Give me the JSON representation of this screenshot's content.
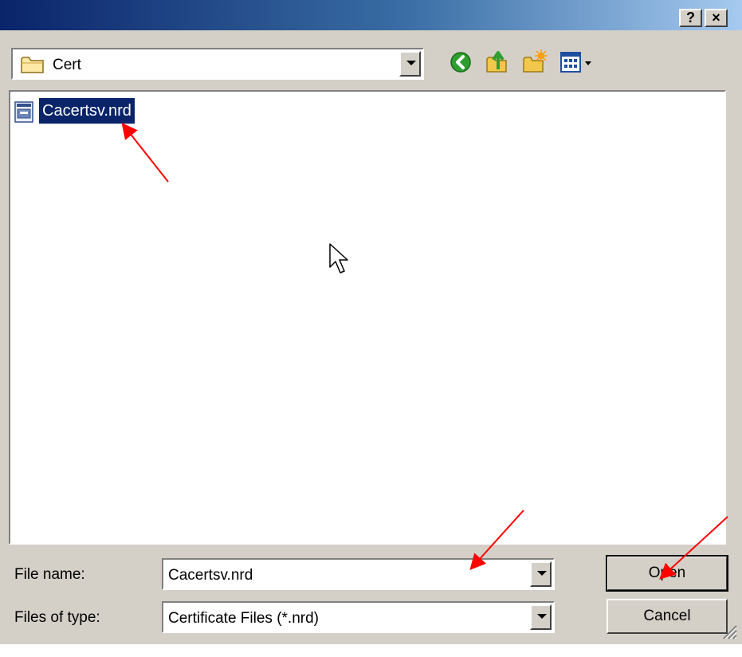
{
  "titlebar": {
    "help_label": "?",
    "close_label": "×"
  },
  "look_in": {
    "value": "Cert",
    "icon": "folder-icon"
  },
  "toolbar": {
    "back_icon": "back-icon",
    "up_icon": "up-folder-icon",
    "new_folder_icon": "new-folder-icon",
    "view_icon": "view-menu-icon"
  },
  "files": [
    {
      "name": "Cacertsv.nrd",
      "icon": "certificate-file-icon",
      "selected": true
    }
  ],
  "form": {
    "file_name_label": "File name:",
    "file_name_value": "Cacertsv.nrd",
    "file_type_label": "Files of type:",
    "file_type_value": "Certificate Files (*.nrd)"
  },
  "buttons": {
    "open_label": "Open",
    "cancel_label": "Cancel"
  },
  "colors": {
    "selection": "#0a246a",
    "face": "#d4d0c8",
    "annotation_arrow": "#ff0000"
  }
}
